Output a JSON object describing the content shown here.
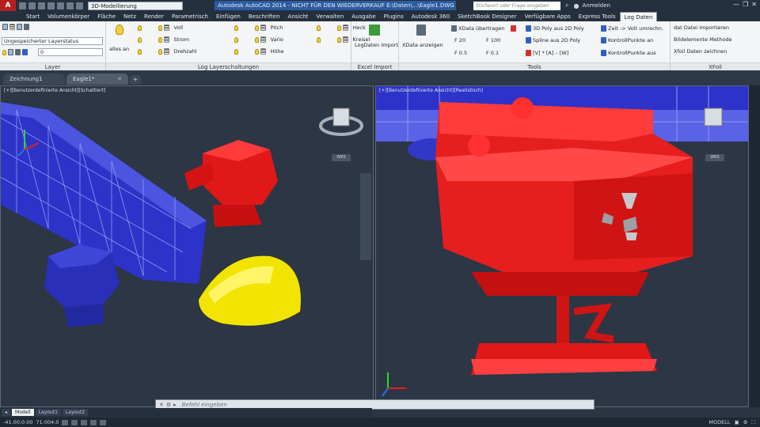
{
  "title_bar": {
    "workspace": "3D-Modellierung",
    "app_title": "Autodesk AutoCAD 2014 - NICHT FÜR DEN WIEDERVERKAUF  E:\\Daten\\...\\Eagle1.DWG",
    "search_placeholder": "Stichwort oder Frage eingeben",
    "user": "Anmelden"
  },
  "ribbon_tabs": [
    "Start",
    "Volumenkörper",
    "Fläche",
    "Netz",
    "Render",
    "Parametrisch",
    "Einfügen",
    "Beschriften",
    "Ansicht",
    "Verwalten",
    "Ausgabe",
    "Plugins",
    "Autodesk 360",
    "SketchBook Designer",
    "Verfügbare Apps",
    "Express Tools",
    "Log Daten"
  ],
  "ribbon": {
    "layer": {
      "state": "Ungespeicherter Layerstatus",
      "current": "0",
      "title": "Layer"
    },
    "alles_an": "alles an",
    "log_layer": {
      "col1": [
        "Voll",
        "Strom",
        "Drehzahl"
      ],
      "col2": [
        "Pitch",
        "Vario",
        "Höhe"
      ],
      "col3": [
        "Heck",
        "Kreisel"
      ],
      "title": "Log Layerschaltungen"
    },
    "excel": {
      "label": "LogDaten Import",
      "title": "Excel Import"
    },
    "tools": {
      "xdata_anzeigen": "XData anzeigen",
      "xdata_uebertragen": "XData übertragen",
      "f20": "F 20",
      "f100": "F 100",
      "f05": "F 0.5",
      "f01": "F 0.1",
      "poly": "3D Poly aus 2D Poly",
      "spline": "Spline aus 2D Poly",
      "minus": "[V] * [A] – [W]",
      "zeit": "Zeit -> Volt umrechn.",
      "kontroll1": "KontrollPunkte an",
      "kontroll2": "KontrollPunkte aus",
      "title": "Tools"
    },
    "xfull": {
      "items": [
        "dat Datei importieren",
        "Bildelemente Methode",
        "Xfoil Daten zeichnen"
      ],
      "title": "XFoil"
    }
  },
  "doc_tabs": [
    "Zeichnung1",
    "Eagle1*"
  ],
  "viewport_left": {
    "label": "[+][Benutzerdefinierte Ansicht][Schattiert]",
    "wcs": "WKS"
  },
  "viewport_right": {
    "label": "[+][Benutzerdefinierte Ansicht][Realistisch]",
    "wcs": "WKS"
  },
  "command_placeholder": "Befehl eingeben",
  "layout_tabs": [
    "Modell",
    "Layout1",
    "Layout2"
  ],
  "status": {
    "coords": "-41.00,0.00",
    "coords2": "71.004.0",
    "modell": "MODELL"
  },
  "colors": {
    "accent": "#2c5b9f",
    "red_model": "#e61e1e",
    "blue_model": "#2c2fc4",
    "yellow_model": "#f3e600"
  }
}
